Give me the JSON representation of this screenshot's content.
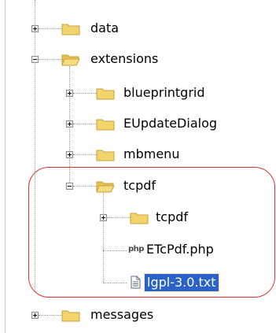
{
  "tree": {
    "items": [
      {
        "label": "data",
        "icon": "folder-icon",
        "expanded": false
      },
      {
        "label": "extensions",
        "icon": "folder-open-icon",
        "expanded": true
      },
      {
        "label": "blueprintgrid",
        "icon": "folder-icon",
        "expanded": false
      },
      {
        "label": "EUpdateDialog",
        "icon": "folder-icon",
        "expanded": false
      },
      {
        "label": "mbmenu",
        "icon": "folder-icon",
        "expanded": false
      },
      {
        "label": "tcpdf",
        "icon": "folder-open-icon",
        "expanded": true
      },
      {
        "label": "tcpdf",
        "icon": "folder-icon",
        "expanded": false
      },
      {
        "label": "ETcPdf.php",
        "icon": "php-file-icon",
        "icon_text": "php"
      },
      {
        "label": "lgpl-3.0.txt",
        "icon": "text-file-icon",
        "selected": true
      },
      {
        "label": "messages",
        "icon": "folder-icon",
        "expanded": false
      }
    ]
  },
  "colors": {
    "selection": "#2a62c8",
    "annotation": "#e03030",
    "folder": "#f3d36b"
  }
}
